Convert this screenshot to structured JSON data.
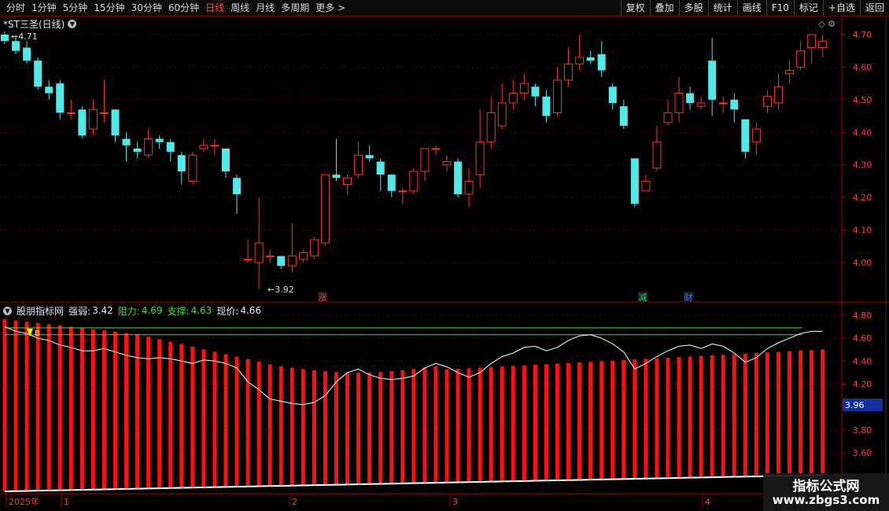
{
  "toolbar": {
    "periods": [
      "分时",
      "1分钟",
      "5分钟",
      "15分钟",
      "30分钟",
      "60分钟",
      "日线",
      "周线",
      "月线",
      "多周期",
      "更多 >"
    ],
    "active_period": "日线",
    "right_buttons": [
      "复权",
      "叠加",
      "多股",
      "统计",
      "画线",
      "F10",
      "标记",
      "+自选",
      "返回"
    ]
  },
  "chart": {
    "title": "*ST三圣(日线)",
    "high_label": "4.71",
    "low_label": "3.92",
    "price_axis": [
      "4.70",
      "4.60",
      "4.50",
      "4.40",
      "4.30",
      "4.20",
      "4.10",
      "4.00"
    ],
    "markers": [
      {
        "text": "涨",
        "color": "#ff3030"
      },
      {
        "text": "减",
        "color": "#30d070"
      },
      {
        "text": "财",
        "color": "#3080ff"
      }
    ]
  },
  "indicator": {
    "name": "股朋指标网",
    "strength_label": "强弱:",
    "strength_value": "3.42",
    "resistance_label": "阻力:",
    "resistance_value": "4.69",
    "support_label": "支撑:",
    "support_value": "4.63",
    "price_label": "现价:",
    "price_value": "4.66",
    "axis": [
      "4.80",
      "4.60",
      "4.40",
      "4.20",
      "3.80",
      "3.60"
    ],
    "axis_highlight": "3.96",
    "marker_label": "B"
  },
  "time_axis": [
    "2025年",
    "1",
    "2",
    "3",
    "4"
  ],
  "watermark": {
    "line1": "指标公式网",
    "line2": "www.zbgs3.com"
  },
  "colors": {
    "up": "#ff3030",
    "down": "#50e8e8",
    "bar": "#ff1010",
    "axis": "#aa0000"
  },
  "chart_data": {
    "type": "candlestick",
    "candles": [
      [
        4.7,
        4.68,
        4.71,
        4.67
      ],
      [
        4.68,
        4.65,
        4.7,
        4.64
      ],
      [
        4.66,
        4.62,
        4.68,
        4.61
      ],
      [
        4.62,
        4.54,
        4.63,
        4.53
      ],
      [
        4.54,
        4.52,
        4.56,
        4.5
      ],
      [
        4.55,
        4.46,
        4.56,
        4.44
      ],
      [
        4.46,
        4.46,
        4.5,
        4.44
      ],
      [
        4.47,
        4.39,
        4.48,
        4.38
      ],
      [
        4.41,
        4.47,
        4.5,
        4.39
      ],
      [
        4.46,
        4.46,
        4.56,
        4.43
      ],
      [
        4.47,
        4.39,
        4.47,
        4.37
      ],
      [
        4.38,
        4.36,
        4.4,
        4.31
      ],
      [
        4.35,
        4.34,
        4.37,
        4.32
      ],
      [
        4.33,
        4.38,
        4.41,
        4.32
      ],
      [
        4.38,
        4.37,
        4.39,
        4.35
      ],
      [
        4.37,
        4.34,
        4.38,
        4.31
      ],
      [
        4.33,
        4.28,
        4.34,
        4.24
      ],
      [
        4.25,
        4.33,
        4.34,
        4.24
      ],
      [
        4.35,
        4.36,
        4.38,
        4.34
      ],
      [
        4.36,
        4.36,
        4.38,
        4.33
      ],
      [
        4.35,
        4.28,
        4.35,
        4.26
      ],
      [
        4.26,
        4.21,
        4.27,
        4.15
      ],
      [
        4.01,
        4.01,
        4.07,
        4.0
      ],
      [
        4.0,
        4.06,
        4.2,
        3.92
      ],
      [
        4.02,
        4.02,
        4.04,
        4.0
      ],
      [
        4.02,
        3.99,
        4.02,
        3.98
      ],
      [
        3.99,
        4.02,
        4.12,
        3.97
      ],
      [
        4.01,
        4.03,
        4.04,
        4.0
      ],
      [
        4.02,
        4.07,
        4.08,
        4.01
      ],
      [
        4.06,
        4.27,
        4.27,
        4.05
      ],
      [
        4.27,
        4.26,
        4.38,
        4.25
      ],
      [
        4.24,
        4.26,
        4.27,
        4.21
      ],
      [
        4.27,
        4.33,
        4.37,
        4.26
      ],
      [
        4.33,
        4.32,
        4.36,
        4.31
      ],
      [
        4.31,
        4.27,
        4.32,
        4.22
      ],
      [
        4.27,
        4.22,
        4.27,
        4.2
      ],
      [
        4.22,
        4.22,
        4.23,
        4.18
      ],
      [
        4.22,
        4.28,
        4.29,
        4.21
      ],
      [
        4.28,
        4.35,
        4.35,
        4.25
      ],
      [
        4.35,
        4.35,
        4.36,
        4.33
      ],
      [
        4.3,
        4.31,
        4.33,
        4.28
      ],
      [
        4.31,
        4.21,
        4.32,
        4.2
      ],
      [
        4.21,
        4.25,
        4.29,
        4.17
      ],
      [
        4.27,
        4.37,
        4.47,
        4.23
      ],
      [
        4.37,
        4.46,
        4.51,
        4.35
      ],
      [
        4.42,
        4.49,
        4.55,
        4.41
      ],
      [
        4.49,
        4.52,
        4.56,
        4.47
      ],
      [
        4.52,
        4.55,
        4.58,
        4.5
      ],
      [
        4.54,
        4.51,
        4.55,
        4.48
      ],
      [
        4.51,
        4.45,
        4.53,
        4.43
      ],
      [
        4.46,
        4.56,
        4.6,
        4.45
      ],
      [
        4.56,
        4.61,
        4.66,
        4.54
      ],
      [
        4.61,
        4.63,
        4.7,
        4.59
      ],
      [
        4.63,
        4.62,
        4.65,
        4.61
      ],
      [
        4.64,
        4.59,
        4.68,
        4.57
      ],
      [
        4.54,
        4.49,
        4.55,
        4.47
      ],
      [
        4.48,
        4.42,
        4.5,
        4.41
      ],
      [
        4.32,
        4.18,
        4.32,
        4.17
      ],
      [
        4.22,
        4.25,
        4.27,
        4.22
      ],
      [
        4.29,
        4.37,
        4.42,
        4.28
      ],
      [
        4.43,
        4.46,
        4.5,
        4.42
      ],
      [
        4.46,
        4.52,
        4.57,
        4.43
      ],
      [
        4.52,
        4.49,
        4.54,
        4.47
      ],
      [
        4.48,
        4.49,
        4.51,
        4.47
      ],
      [
        4.62,
        4.5,
        4.69,
        4.45
      ],
      [
        4.49,
        4.49,
        4.51,
        4.46
      ],
      [
        4.5,
        4.47,
        4.52,
        4.43
      ],
      [
        4.44,
        4.34,
        4.44,
        4.32
      ],
      [
        4.37,
        4.41,
        4.43,
        4.33
      ],
      [
        4.48,
        4.51,
        4.53,
        4.46
      ],
      [
        4.49,
        4.54,
        4.58,
        4.47
      ],
      [
        4.58,
        4.59,
        4.62,
        4.55
      ],
      [
        4.6,
        4.65,
        4.68,
        4.59
      ],
      [
        4.66,
        4.7,
        4.7,
        4.61
      ],
      [
        4.66,
        4.68,
        4.7,
        4.63
      ]
    ],
    "indicator_line": [
      4.7,
      4.66,
      4.64,
      4.6,
      4.58,
      4.54,
      4.52,
      4.49,
      4.49,
      4.51,
      4.48,
      4.45,
      4.43,
      4.42,
      4.43,
      4.42,
      4.4,
      4.38,
      4.41,
      4.4,
      4.38,
      4.34,
      4.22,
      4.15,
      4.07,
      4.05,
      4.03,
      4.02,
      4.04,
      4.1,
      4.22,
      4.3,
      4.33,
      4.28,
      4.25,
      4.24,
      4.25,
      4.27,
      4.34,
      4.38,
      4.35,
      4.3,
      4.26,
      4.3,
      4.38,
      4.44,
      4.47,
      4.52,
      4.53,
      4.49,
      4.52,
      4.58,
      4.62,
      4.63,
      4.6,
      4.55,
      4.48,
      4.33,
      4.38,
      4.44,
      4.49,
      4.53,
      4.54,
      4.51,
      4.55,
      4.53,
      4.47,
      4.39,
      4.43,
      4.51,
      4.56,
      4.6,
      4.64,
      4.66,
      4.66
    ],
    "resistance": 4.69,
    "support": 4.63
  }
}
